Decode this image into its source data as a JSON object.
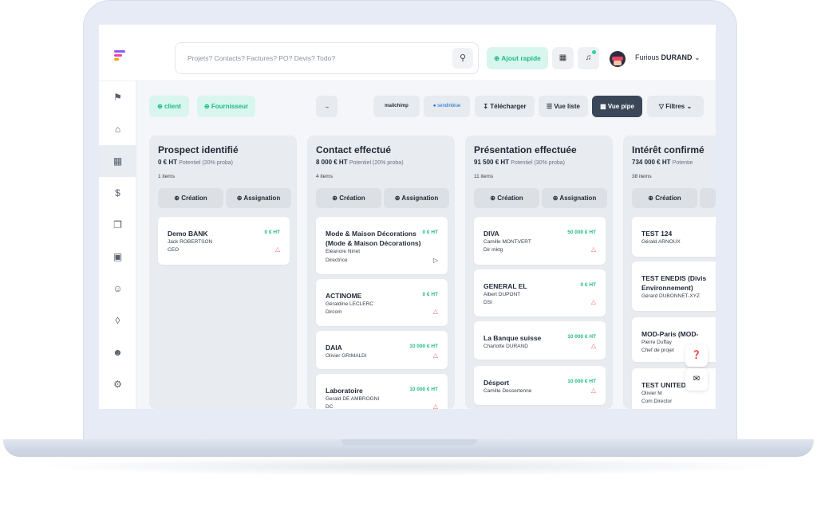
{
  "header": {
    "search_placeholder": "Projets? Contacts? Factures? PO? Devis? Todo?",
    "quick_add": "Ajout rapide",
    "user_first": "Furious",
    "user_last": "DURAND"
  },
  "toolbar": {
    "client": "client",
    "fournisseur": "Fournisseur",
    "mailchimp": "mailchimp",
    "sendinblue": "sendinblue",
    "telecharger": "Télécharger",
    "vue_liste": "Vue liste",
    "vue_pipe": "Vue pipe",
    "filtres": "Filtres"
  },
  "columns": [
    {
      "title": "Prospect identifié",
      "amount": "0 € HT",
      "potential": "Potentiel (20% proba)",
      "count": "1 items",
      "create": "Création",
      "assign": "Assignation",
      "cards": [
        {
          "title": "Demo BANK",
          "amount": "0 € HT",
          "contact": "Jack ROBERTSON",
          "role": "CEO"
        }
      ]
    },
    {
      "title": "Contact effectué",
      "amount": "8 000 € HT",
      "potential": "Potentiel (20% proba)",
      "count": "4 items",
      "create": "Création",
      "assign": "Assignation",
      "cards": [
        {
          "title": "Mode & Maison Décorations (Mode & Maison Décorations)",
          "amount": "0 € HT",
          "contact": "Eléanore Ninet",
          "role": "Directrice"
        },
        {
          "title": "ACTINOME",
          "amount": "0 € HT",
          "contact": "Géraldine LECLERC",
          "role": "Dircom"
        },
        {
          "title": "DAIA",
          "amount": "10 000 € HT",
          "contact": "Olivier GRIMALDI",
          "role": ""
        },
        {
          "title": "Laboratoire",
          "amount": "10 000 € HT",
          "contact": "Gerald DE AMBROGNI",
          "role": "DC"
        }
      ]
    },
    {
      "title": "Présentation effectuée",
      "amount": "91 500 € HT",
      "potential": "Potentiel (30% proba)",
      "count": "11 items",
      "create": "Création",
      "assign": "Assignation",
      "cards": [
        {
          "title": "DIVA",
          "amount": "50 000 € HT",
          "contact": "Camille MONTVERT",
          "role": "Dir mktg"
        },
        {
          "title": "GENERAL EL",
          "amount": "0 € HT",
          "contact": "Albert DUPONT",
          "role": "DSI"
        },
        {
          "title": "La Banque suisse",
          "amount": "10 000 € HT",
          "contact": "Charlotte DURAND",
          "role": ""
        },
        {
          "title": "Désport",
          "amount": "10 000 € HT",
          "contact": "Camille Dessertenne",
          "role": ""
        }
      ]
    },
    {
      "title": "Intérêt confirmé",
      "amount": "734 000 € HT",
      "potential": "Potentie",
      "count": "38 items",
      "create": "Création",
      "cards": [
        {
          "title": "TEST 124",
          "contact": "Gérald ARNOUX"
        },
        {
          "title": "TEST ENEDIS (Divis Environnement)",
          "contact": "Gérard DUBONNET-XYZ"
        },
        {
          "title": "MOD-Paris (MOD-",
          "contact": "Pierre Duffay",
          "role": "Chef de projet"
        },
        {
          "title": "TEST UNITED",
          "contact": "Olivier M",
          "role": "Com Director"
        }
      ]
    }
  ],
  "colors": {
    "accent": "#21b989",
    "accent_bg": "#d9f6ee",
    "dark_button": "#3a4759",
    "warning": "#ef6b6b"
  }
}
